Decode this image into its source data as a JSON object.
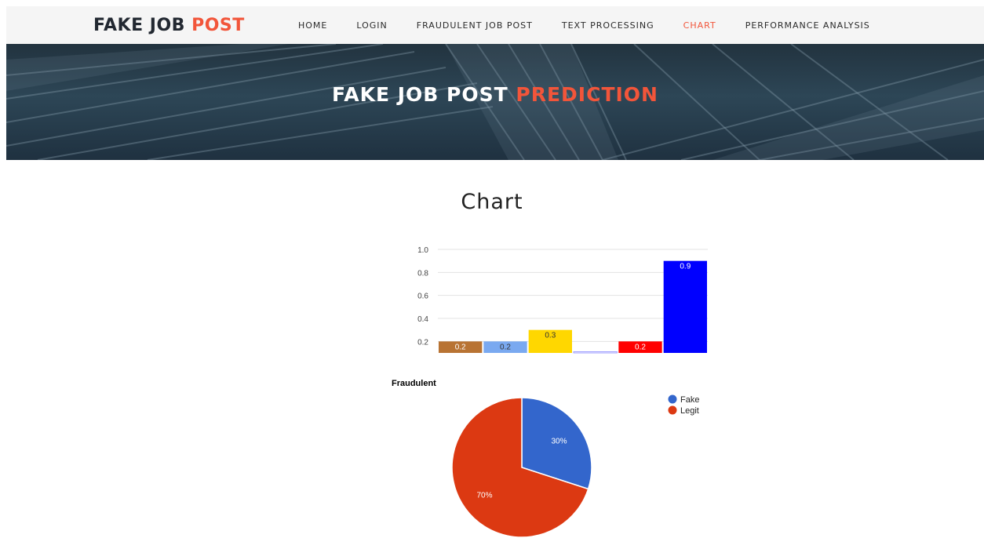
{
  "brand": {
    "part1": "FAKE JOB ",
    "part2": "POST"
  },
  "nav": {
    "items": [
      "HOME",
      "LOGIN",
      "FRAUDULENT JOB POST",
      "TEXT PROCESSING",
      "CHART",
      "PERFORMANCE ANALYSIS"
    ],
    "active": "CHART"
  },
  "hero": {
    "part1": "FAKE JOB POST ",
    "part2": "PREDICTION"
  },
  "page_title": "Chart",
  "colors": {
    "accent": "#f2553a"
  },
  "chart_data": [
    {
      "type": "bar",
      "values": [
        0.2,
        0.2,
        0.3,
        0.0,
        0.2,
        0.9
      ],
      "data_labels": [
        "0.2",
        "0.2",
        "0.3",
        "",
        "0.2",
        "0.9"
      ],
      "colors": [
        "#b87333",
        "#7aa9f0",
        "#ffd700",
        "#ffffff",
        "#ff0000",
        "#0000ff"
      ],
      "ytick_labels": [
        "0.2",
        "0.4",
        "0.6",
        "0.8",
        "1.0"
      ],
      "ylim": [
        0.1,
        1.0
      ],
      "grid": true
    },
    {
      "type": "pie",
      "title": "Fraudulent",
      "labels": [
        "Fake",
        "Legit"
      ],
      "values": [
        30,
        70
      ],
      "value_labels": [
        "30%",
        "70%"
      ],
      "colors": [
        "#3366cc",
        "#dc3912"
      ],
      "legend": "right"
    }
  ]
}
